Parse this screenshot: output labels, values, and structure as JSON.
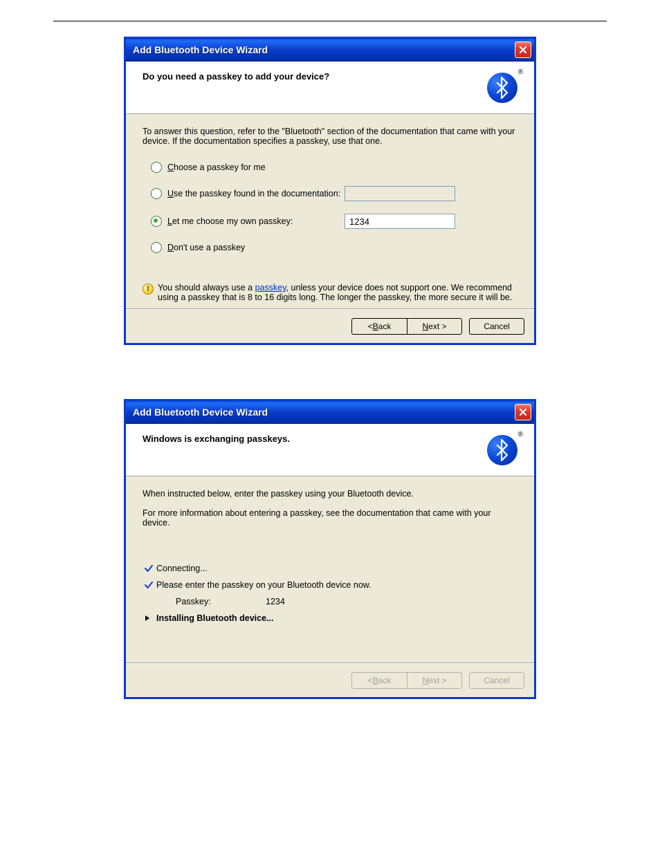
{
  "dialog1": {
    "title": "Add Bluetooth Device Wizard",
    "registered_mark": "®",
    "header": "Do you need a passkey to add your device?",
    "intro": "To answer this question, refer to the \"Bluetooth\" section of the documentation that came with your device. If the documentation specifies a passkey, use that one.",
    "options": {
      "choose_for_me": "hoose a passkey for me",
      "choose_for_me_m": "C",
      "use_doc": "se the passkey found in the documentation:",
      "use_doc_m": "U",
      "own": "et me choose my own passkey:",
      "own_m": "L",
      "none": "on't use a passkey",
      "none_m": "D"
    },
    "own_passkey_value": "1234",
    "info_prefix": "You should always use a ",
    "info_link": "passkey",
    "info_suffix": ", unless your device does not support one. We recommend using a passkey that is 8 to 16 digits long. The longer the passkey, the more secure it will be.",
    "buttons": {
      "back_pre": "< ",
      "back_m": "B",
      "back_post": "ack",
      "next_m": "N",
      "next_post": "ext >",
      "cancel": "Cancel"
    }
  },
  "dialog2": {
    "title": "Add Bluetooth Device Wizard",
    "registered_mark": "®",
    "header": "Windows is exchanging passkeys.",
    "line1": "When instructed below, enter the passkey using your Bluetooth device.",
    "line2": "For more information about entering a passkey, see the documentation that came with your device.",
    "status": {
      "connecting": "Connecting...",
      "enter_now": "Please enter the passkey on your Bluetooth device now.",
      "passkey_label": "Passkey:",
      "passkey_value": "1234",
      "installing": "Installing Bluetooth device..."
    },
    "buttons": {
      "back_pre": "< ",
      "back_m": "B",
      "back_post": "ack",
      "next_m": "N",
      "next_post": "ext >",
      "cancel": "Cancel"
    }
  }
}
